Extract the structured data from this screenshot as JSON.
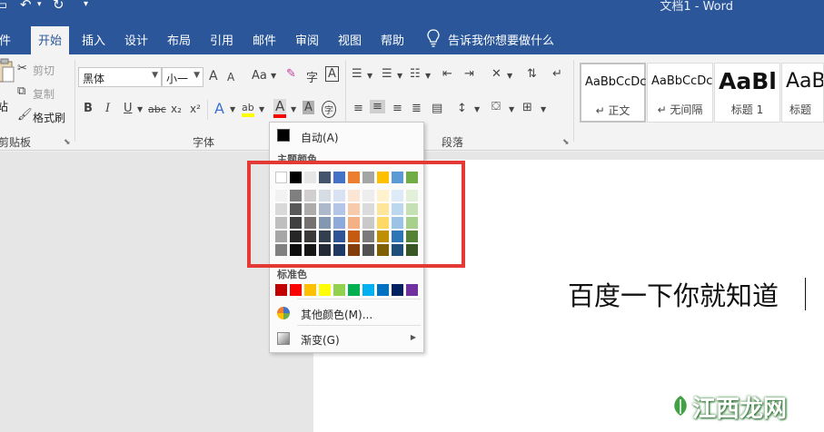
{
  "window": {
    "title": "文档1 - Word"
  },
  "quick_access": {
    "save_icon": "save-icon",
    "undo_icon": "undo-icon",
    "redo_icon": "redo-icon",
    "customize_icon": "customize-icon"
  },
  "tabs": [
    {
      "label": "件"
    },
    {
      "label": "开始"
    },
    {
      "label": "插入"
    },
    {
      "label": "设计"
    },
    {
      "label": "布局"
    },
    {
      "label": "引用"
    },
    {
      "label": "邮件"
    },
    {
      "label": "审阅"
    },
    {
      "label": "视图"
    },
    {
      "label": "帮助"
    }
  ],
  "tell_me": "告诉我你想要做什么",
  "clipboard": {
    "paste_label": "站",
    "cut": "剪切",
    "copy": "复制",
    "format_painter": "格式刷",
    "group_label": "剪贴板"
  },
  "font": {
    "font_name": "黑体",
    "font_size": "小一",
    "grow_label": "A",
    "shrink_label": "A",
    "case_label": "Aa",
    "phonetic_label": "字",
    "border_label": "A",
    "bold": "B",
    "italic": "I",
    "underline": "U",
    "strikethrough": "abc",
    "subscript": "x₂",
    "superscript": "x²",
    "effects_label": "A",
    "highlight_label": "ab",
    "font_color_label": "A",
    "shading_label": "A",
    "enclose_label": "字",
    "group_label": "字体"
  },
  "paragraph": {
    "group_label": "段落"
  },
  "styles": [
    {
      "sample": "AaBbCcDc",
      "name": "↵ 正文"
    },
    {
      "sample": "AaBbCcDc",
      "name": "↵ 无间隔"
    },
    {
      "sample": "AaBl",
      "name": "标题 1"
    },
    {
      "sample": "AaB",
      "name": "标题"
    }
  ],
  "document": {
    "text": "百度一下你就知道"
  },
  "color_menu": {
    "automatic": "自动(A)",
    "theme_heading": "主题颜色",
    "standard_heading": "标准色",
    "more_colors": "其他颜色(M)...",
    "gradient": "渐变(G)",
    "theme_top": [
      "#ffffff",
      "#000000",
      "#e7e6e6",
      "#44546a",
      "#4472c4",
      "#ed7d31",
      "#a5a5a5",
      "#ffc000",
      "#5b9bd5",
      "#70ad47"
    ],
    "theme_shades": [
      [
        "#f2f2f2",
        "#d9d9d9",
        "#bfbfbf",
        "#a6a6a6",
        "#808080"
      ],
      [
        "#7f7f7f",
        "#595959",
        "#404040",
        "#262626",
        "#0d0d0d"
      ],
      [
        "#d0cece",
        "#aeabab",
        "#757171",
        "#3a3838",
        "#171616"
      ],
      [
        "#d6dce4",
        "#adb9ca",
        "#8497b0",
        "#333f4f",
        "#222a35"
      ],
      [
        "#d9e2f3",
        "#b4c6e7",
        "#8eaadb",
        "#2f5496",
        "#1f3864"
      ],
      [
        "#fbe5d5",
        "#f7caac",
        "#f4b183",
        "#c55a11",
        "#833c0b"
      ],
      [
        "#ededed",
        "#dbdbdb",
        "#c9c9c9",
        "#7b7b7b",
        "#525252"
      ],
      [
        "#fff2cc",
        "#fee599",
        "#ffd966",
        "#bf8f00",
        "#7f6000"
      ],
      [
        "#deebf6",
        "#bdd7ee",
        "#9cc3e5",
        "#2e75b5",
        "#1e4e79"
      ],
      [
        "#e2efd9",
        "#c5e0b3",
        "#a8d08d",
        "#538135",
        "#375623"
      ]
    ],
    "standard": [
      "#c00000",
      "#ff0000",
      "#ffc000",
      "#ffff00",
      "#92d050",
      "#00b050",
      "#00b0f0",
      "#0070c0",
      "#002060",
      "#7030a0"
    ]
  },
  "watermark": {
    "text": "江西龙网"
  }
}
